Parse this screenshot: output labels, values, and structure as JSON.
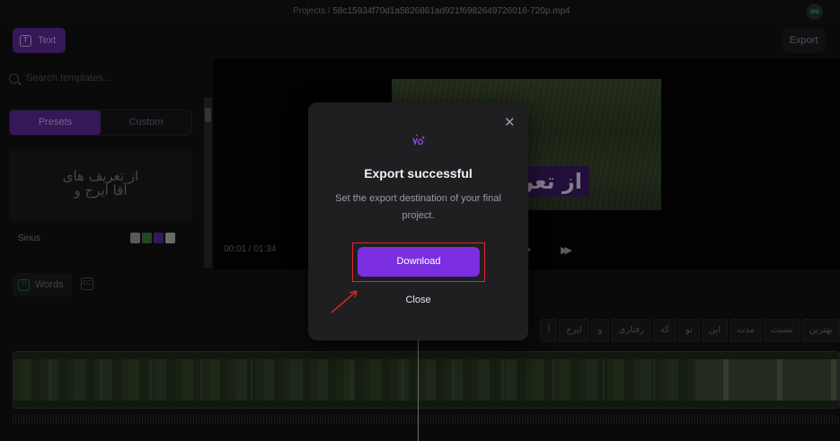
{
  "header": {
    "project_label": "Projects /",
    "file_name": "58c15934f70d1a5826861ad921f6982649726016-720p.mp4",
    "avatar_text": "oo",
    "text_button": "Text",
    "export_button": "Export"
  },
  "left_panel": {
    "search_placeholder": "Search templates...",
    "tabs": [
      {
        "label": "Presets",
        "active": true
      },
      {
        "label": "Custom",
        "active": false
      }
    ],
    "preset": {
      "preview_line1": "از تعریف های",
      "preview_line2": "آقا ایرج و",
      "name": "Sinus",
      "swatches": [
        "#9a9a9a",
        "#3f7a3f",
        "#5a2a97",
        "#b8b8b8"
      ]
    },
    "words_button": "Words",
    "cc_label": "CC"
  },
  "preview": {
    "caption": "از تعریف",
    "timecode": "00:01 / 01:34"
  },
  "timeline": {
    "words": [
      "بهترین",
      "نسبت",
      "مدت",
      "این",
      "تو",
      "که",
      "رفتاری",
      "و",
      "ایرج",
      "آ"
    ]
  },
  "modal": {
    "title": "Export successful",
    "description": "Set the export destination of your final project.",
    "download_label": "Download",
    "close_label": "Close",
    "accent_color": "#7b2fe0",
    "highlight_color": "#e0262a"
  }
}
